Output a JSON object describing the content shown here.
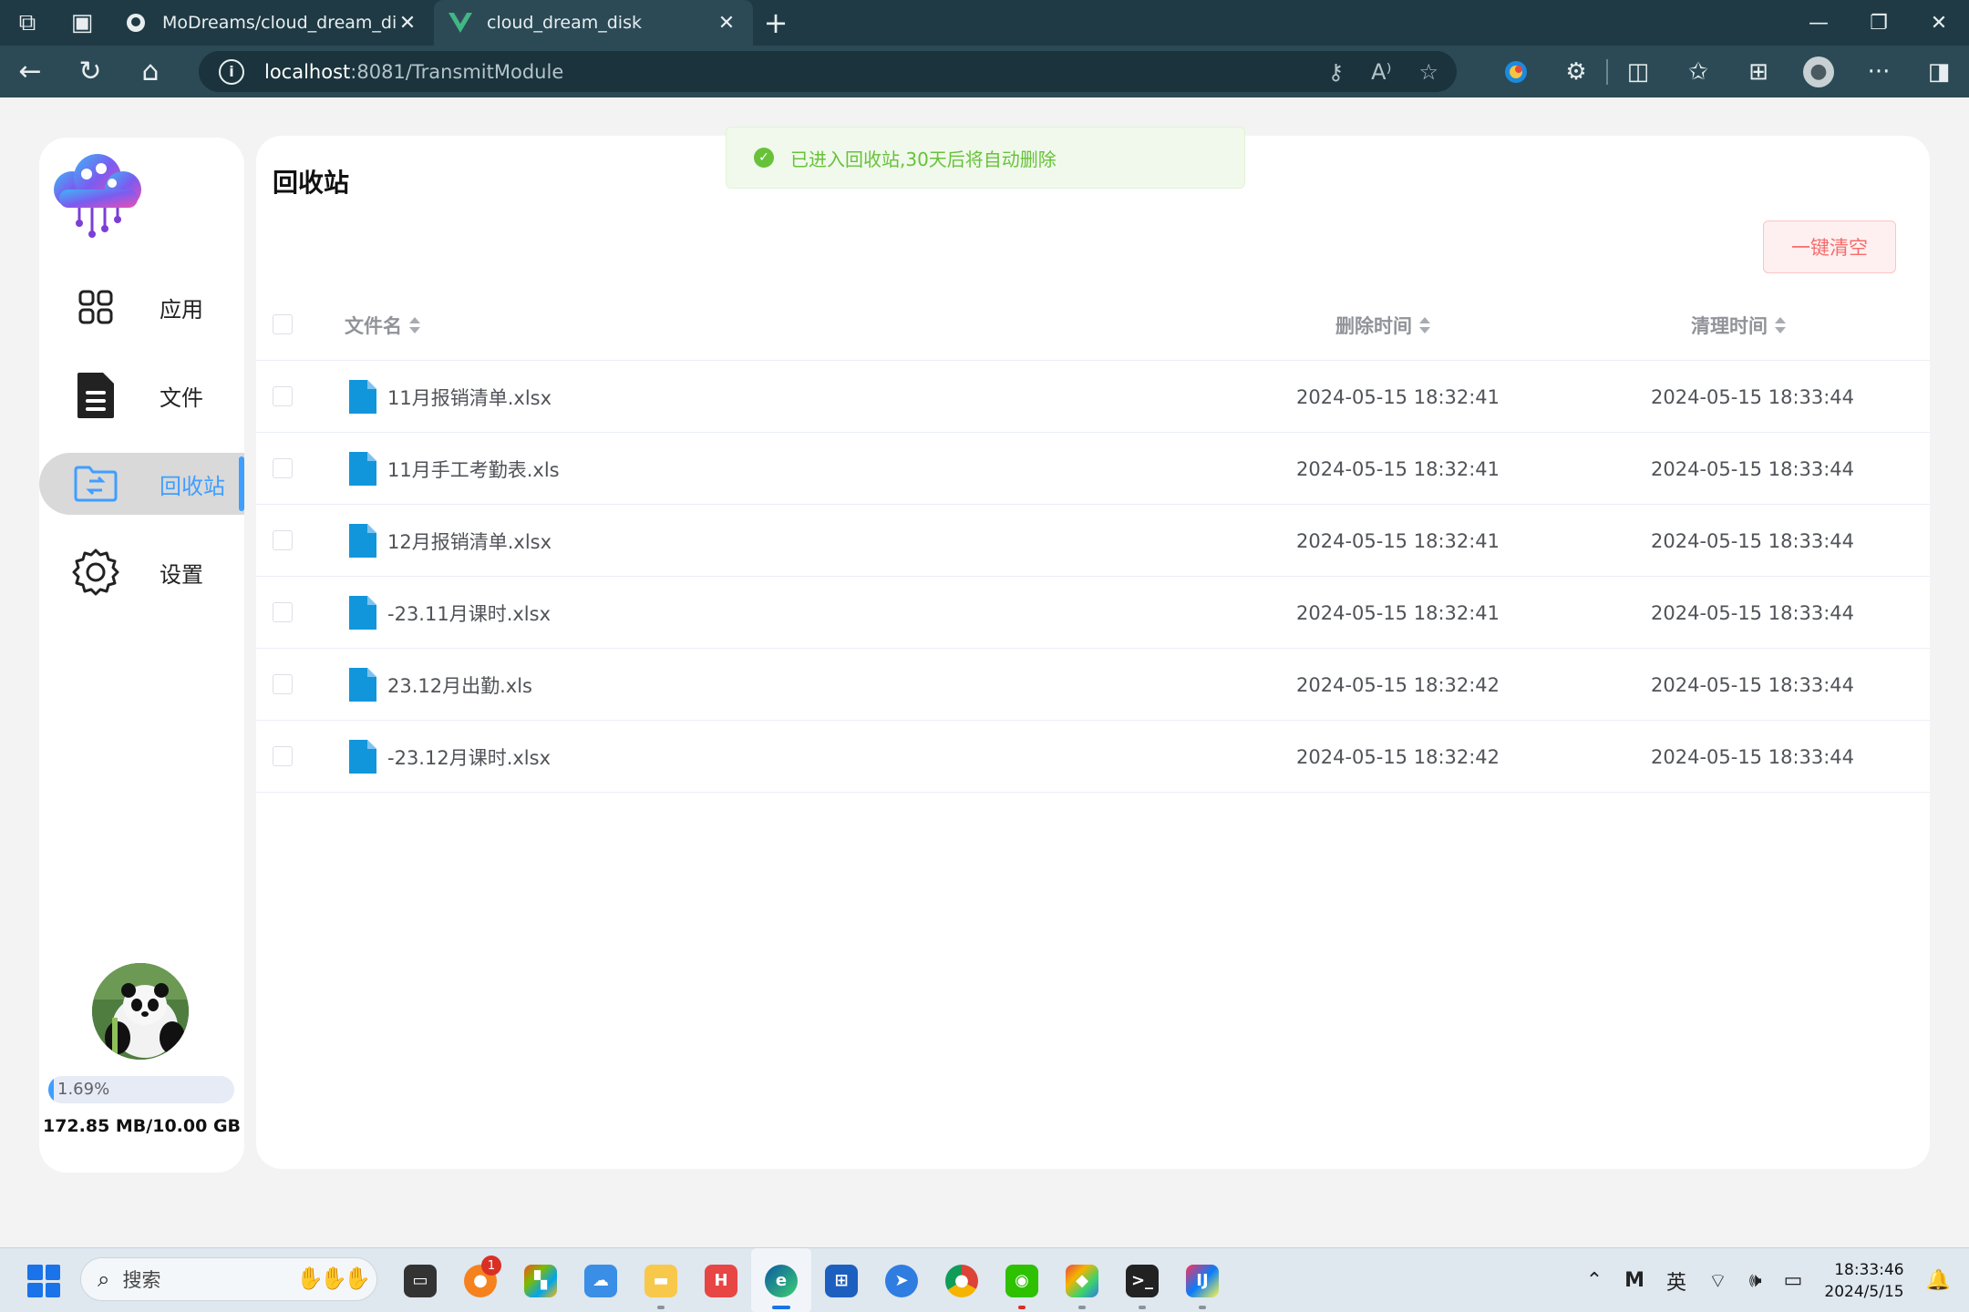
{
  "browser": {
    "tabs": [
      {
        "title": "MoDreams/cloud_dream_disk: ~",
        "favicon": "github-icon",
        "active": false
      },
      {
        "title": "cloud_dream_disk",
        "favicon": "vue-icon",
        "active": true
      }
    ],
    "url": {
      "host": "localhost",
      "path": ":8081/TransmitModule"
    }
  },
  "sidebar": {
    "nav": [
      {
        "label": "应用",
        "icon": "apps-grid-icon",
        "active": false
      },
      {
        "label": "文件",
        "icon": "file-icon",
        "active": false
      },
      {
        "label": "回收站",
        "icon": "recycle-folder-icon",
        "active": true
      },
      {
        "label": "设置",
        "icon": "gear-icon",
        "active": false
      }
    ],
    "storage": {
      "percent_label": "1.69%",
      "percent": 1.69,
      "usage_label": "172.85 MB/10.00 GB"
    }
  },
  "main": {
    "title": "回收站",
    "clear_button": "一键清空",
    "toast": "已进入回收站,30天后将自动删除",
    "columns": {
      "name": "文件名",
      "deleted": "删除时间",
      "cleanup": "清理时间"
    },
    "rows": [
      {
        "name": "11月报销清单.xlsx",
        "deleted": "2024-05-15 18:32:41",
        "cleanup": "2024-05-15 18:33:44"
      },
      {
        "name": "11月手工考勤表.xls",
        "deleted": "2024-05-15 18:32:41",
        "cleanup": "2024-05-15 18:33:44"
      },
      {
        "name": "12月报销清单.xlsx",
        "deleted": "2024-05-15 18:32:41",
        "cleanup": "2024-05-15 18:33:44"
      },
      {
        "name": "-23.11月课时.xlsx",
        "deleted": "2024-05-15 18:32:41",
        "cleanup": "2024-05-15 18:33:44"
      },
      {
        "name": "23.12月出勤.xls",
        "deleted": "2024-05-15 18:32:42",
        "cleanup": "2024-05-15 18:33:44"
      },
      {
        "name": "-23.12月课时.xlsx",
        "deleted": "2024-05-15 18:32:42",
        "cleanup": "2024-05-15 18:33:44"
      }
    ]
  },
  "taskbar": {
    "search_placeholder": "搜索",
    "badge_count": "1",
    "ime": "英",
    "time": "18:33:46",
    "date": "2024/5/15"
  },
  "colors": {
    "accent": "#409eff",
    "success": "#67c23a",
    "danger": "#f56c6c",
    "chrome": "#1f3a44"
  }
}
